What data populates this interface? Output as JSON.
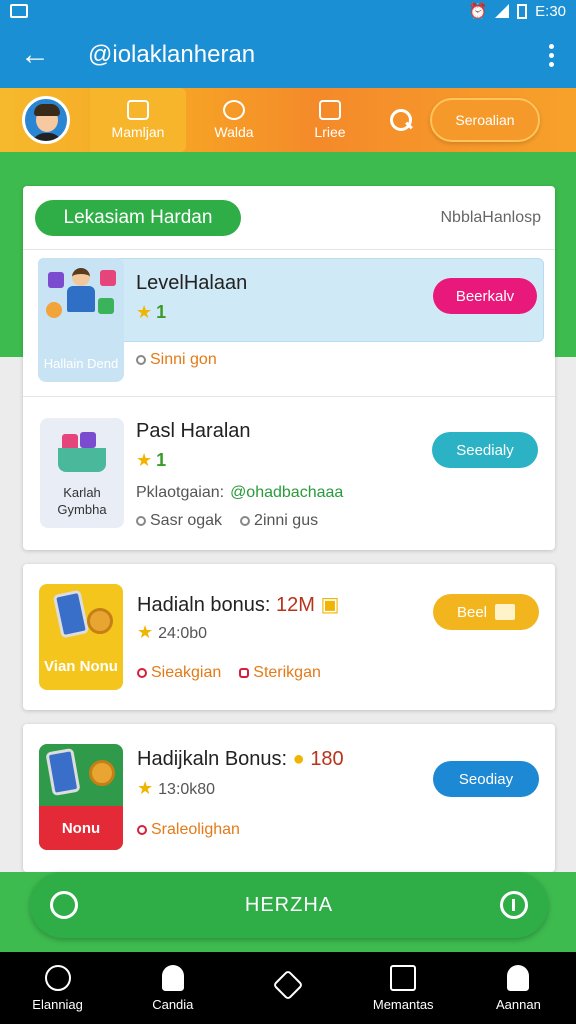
{
  "status_bar": {
    "time": "E:30"
  },
  "app_bar": {
    "title": "@iolaklanheran"
  },
  "top_tabs": [
    {
      "label": "Mamljan",
      "icon": "gift-icon"
    },
    {
      "label": "Walda",
      "icon": "coin-icon"
    },
    {
      "label": "Lriee",
      "icon": "tag-icon"
    }
  ],
  "top_action": {
    "label": "Seroalian"
  },
  "section": {
    "pill": "Lekasiam Hardan",
    "subtitle": "NbblaHanlosp"
  },
  "items": [
    {
      "title": "LevelHalaan",
      "stars": "1",
      "meta1": "Sinni gon",
      "button": "Beerkalv",
      "thumb_label": "Hallain Dend"
    },
    {
      "title": "Pasl Haralan",
      "stars": "1",
      "meta1_label": "Pklaotgaian:",
      "meta1_value": "@ohadbachaaa",
      "meta2": "Sasr ogak",
      "meta3": "2inni gus",
      "button": "Seedialy",
      "thumb_label": "Karlah Gymbha"
    },
    {
      "title": "Hadialn bonus:",
      "amount": "12M",
      "stars": "24:0b0",
      "meta1": "Sieakgian",
      "meta2": "Sterikgan",
      "button": "Beel",
      "thumb_label": "Vian Nonu"
    },
    {
      "title": "Hadijkaln Bonus:",
      "amount": "180",
      "stars": "13:0k80",
      "meta1": "Sraleolighan",
      "button": "Seodiay",
      "thumb_label": "Nonu"
    }
  ],
  "bottom_action": {
    "label": "HERZHA"
  },
  "nav": [
    {
      "label": "Elanniag",
      "icon": "circle-icon"
    },
    {
      "label": "Candia",
      "icon": "person-icon"
    },
    {
      "label": "",
      "icon": "home-icon"
    },
    {
      "label": "Memantas",
      "icon": "box-icon"
    },
    {
      "label": "Aannan",
      "icon": "profile-icon"
    }
  ]
}
